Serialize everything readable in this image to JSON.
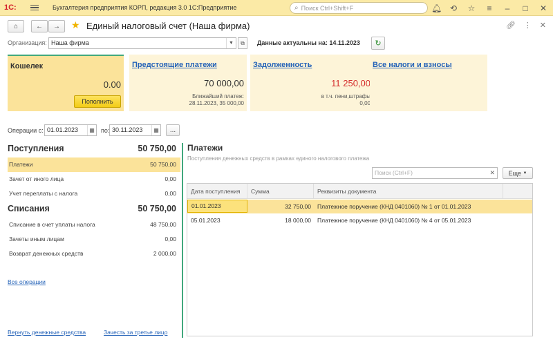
{
  "titlebar": {
    "logo": "1С:",
    "app_title": "Бухгалтерия предприятия КОРП, редакция 3.0 1С:Предприятие",
    "search_placeholder": "Поиск Ctrl+Shift+F"
  },
  "header": {
    "title": "Единый налоговый счет (Наша фирма)"
  },
  "org": {
    "label": "Организация:",
    "value": "Наша фирма",
    "actual_label": "Данные актуальны на: 14.11.2023"
  },
  "cards": {
    "wallet": {
      "title": "Кошелек",
      "amount": "0.00",
      "button": "Пополнить"
    },
    "upcoming": {
      "title": "Предстоящие платежи",
      "amount": "70 000,00",
      "note_1": "Ближайший платеж:",
      "note_2": "28.11.2023, 35 000,00"
    },
    "debt": {
      "title": "Задолженность",
      "amount": "11 250,00",
      "note_1": "в т.ч. пени,штрафы",
      "note_2": "0,00"
    },
    "all": {
      "title": "Все налоги и взносы"
    }
  },
  "operations": {
    "label": "Операции с:",
    "from": "01.01.2023",
    "to_label": "по:",
    "to": "30.11.2023",
    "dots": "..."
  },
  "left": {
    "income": {
      "title": "Поступления",
      "total": "50 750,00"
    },
    "income_rows": [
      {
        "label": "Платежи",
        "value": "50 750,00"
      },
      {
        "label": "Зачет от иного лица",
        "value": "0,00"
      },
      {
        "label": "Учет переплаты с налога",
        "value": "0,00"
      }
    ],
    "outgo": {
      "title": "Списания",
      "total": "50 750,00"
    },
    "outgo_rows": [
      {
        "label": "Списание в счет уплаты налога",
        "value": "48 750,00"
      },
      {
        "label": "Зачеты иным лицам",
        "value": "0,00"
      },
      {
        "label": "Возврат денежных средств",
        "value": "2 000,00"
      }
    ],
    "all_ops_link": "Все операции",
    "return_link": "Вернуть денежные средства",
    "offset_link": "Зачесть за третье лицо"
  },
  "payments": {
    "title": "Платежи",
    "subtitle": "Поступления денежных средств в рамках единого налогового платежа",
    "search_placeholder": "Поиск (Ctrl+F)",
    "more": "Еще",
    "columns": [
      "Дата поступления",
      "Сумма",
      "Реквизиты документа"
    ],
    "rows": [
      {
        "date": "01.01.2023",
        "sum": "32 750,00",
        "doc": "Платежное поручение (КНД 0401060) № 1 от 01.01.2023"
      },
      {
        "date": "05.01.2023",
        "sum": "18 000,00",
        "doc": "Платежное поручение (КНД 0401060) № 4 от 05.01.2023"
      }
    ]
  },
  "colors": {
    "titlebar": "#fbeaa6",
    "accent_yellow": "#fbe39a",
    "link": "#2563b8",
    "debt_red": "#d42c2c",
    "green_accent": "#42a87c"
  }
}
